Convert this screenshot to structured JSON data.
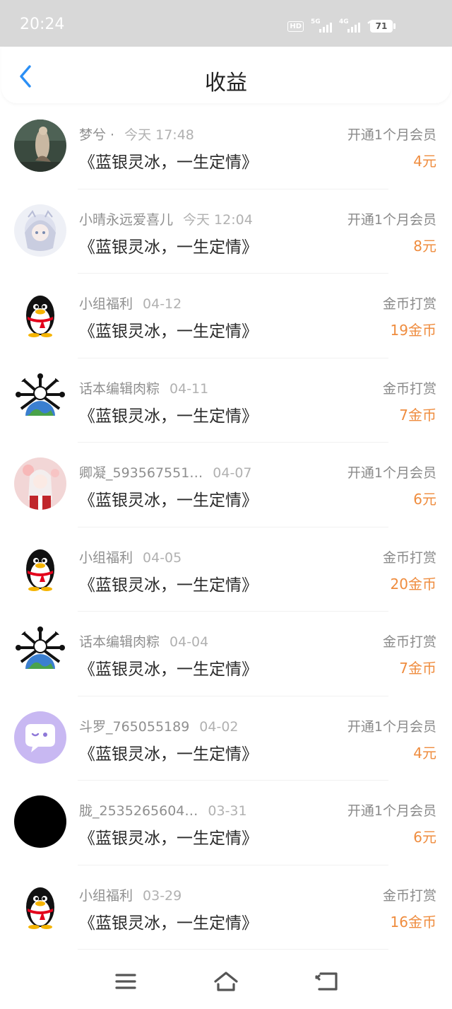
{
  "status_bar": {
    "time": "20:24",
    "hd_label": "HD",
    "net1": "5G",
    "net2": "4G",
    "battery": "71"
  },
  "header": {
    "title": "收益",
    "back_icon": "chevron-left-icon",
    "accent": "#2b8ff5"
  },
  "records": [
    {
      "name": "梦兮 ·",
      "time": "今天 17:48",
      "book": "《蓝银灵冰，一生定情》",
      "type": "开通1个月会员",
      "amount": "4元",
      "avatar": "photo-avatar"
    },
    {
      "name": "小晴永远爱喜儿",
      "time": "今天 12:04",
      "book": "《蓝银灵冰，一生定情》",
      "type": "开通1个月会员",
      "amount": "8元",
      "avatar": "anime-avatar"
    },
    {
      "name": "小组福利",
      "time": "04-12",
      "book": "《蓝银灵冰，一生定情》",
      "type": "金币打赏",
      "amount": "19金币",
      "avatar": "penguin-avatar"
    },
    {
      "name": "话本编辑肉粽",
      "time": "04-11",
      "book": "《蓝银灵冰，一生定情》",
      "type": "金币打赏",
      "amount": "7金币",
      "avatar": "globe-avatar"
    },
    {
      "name": "卿凝_593567551…",
      "time": "04-07",
      "book": "《蓝银灵冰，一生定情》",
      "type": "开通1个月会员",
      "amount": "6元",
      "avatar": "anime-girl-avatar"
    },
    {
      "name": "小组福利",
      "time": "04-05",
      "book": "《蓝银灵冰，一生定情》",
      "type": "金币打赏",
      "amount": "20金币",
      "avatar": "penguin-avatar"
    },
    {
      "name": "话本编辑肉粽",
      "time": "04-04",
      "book": "《蓝银灵冰，一生定情》",
      "type": "金币打赏",
      "amount": "7金币",
      "avatar": "globe-avatar"
    },
    {
      "name": "斗罗_765055189",
      "time": "04-02",
      "book": "《蓝银灵冰，一生定情》",
      "type": "开通1个月会员",
      "amount": "4元",
      "avatar": "chat-bubble-avatar"
    },
    {
      "name": "胧_2535265604…",
      "time": "03-31",
      "book": "《蓝银灵冰，一生定情》",
      "type": "开通1个月会员",
      "amount": "6元",
      "avatar": "black-avatar"
    },
    {
      "name": "小组福利",
      "time": "03-29",
      "book": "《蓝银灵冰，一生定情》",
      "type": "金币打赏",
      "amount": "16金币",
      "avatar": "penguin-avatar"
    }
  ],
  "amount_color": "#ef8c3e",
  "nav_bar": {
    "menu_icon": "menu-icon",
    "home_icon": "home-icon",
    "back_icon": "back-arrow-icon"
  }
}
